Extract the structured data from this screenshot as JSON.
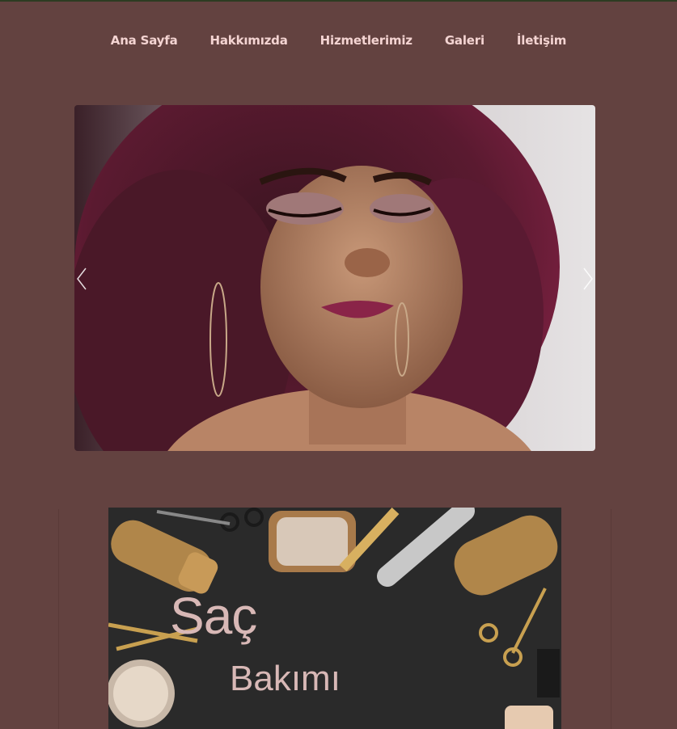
{
  "nav": {
    "items": [
      {
        "label": "Ana Sayfa"
      },
      {
        "label": "Hakkımızda"
      },
      {
        "label": "Hizmetlerimiz"
      },
      {
        "label": "Galeri"
      },
      {
        "label": "İletişim"
      }
    ]
  },
  "carousel": {
    "prev_icon": "chevron-left-icon",
    "next_icon": "chevron-right-icon"
  },
  "card": {
    "title_line1": "Saç",
    "title_line2": "Bakımı"
  },
  "colors": {
    "background": "#634240",
    "nav_text": "#f4d4d2",
    "card_title": "#d8b8b6"
  }
}
